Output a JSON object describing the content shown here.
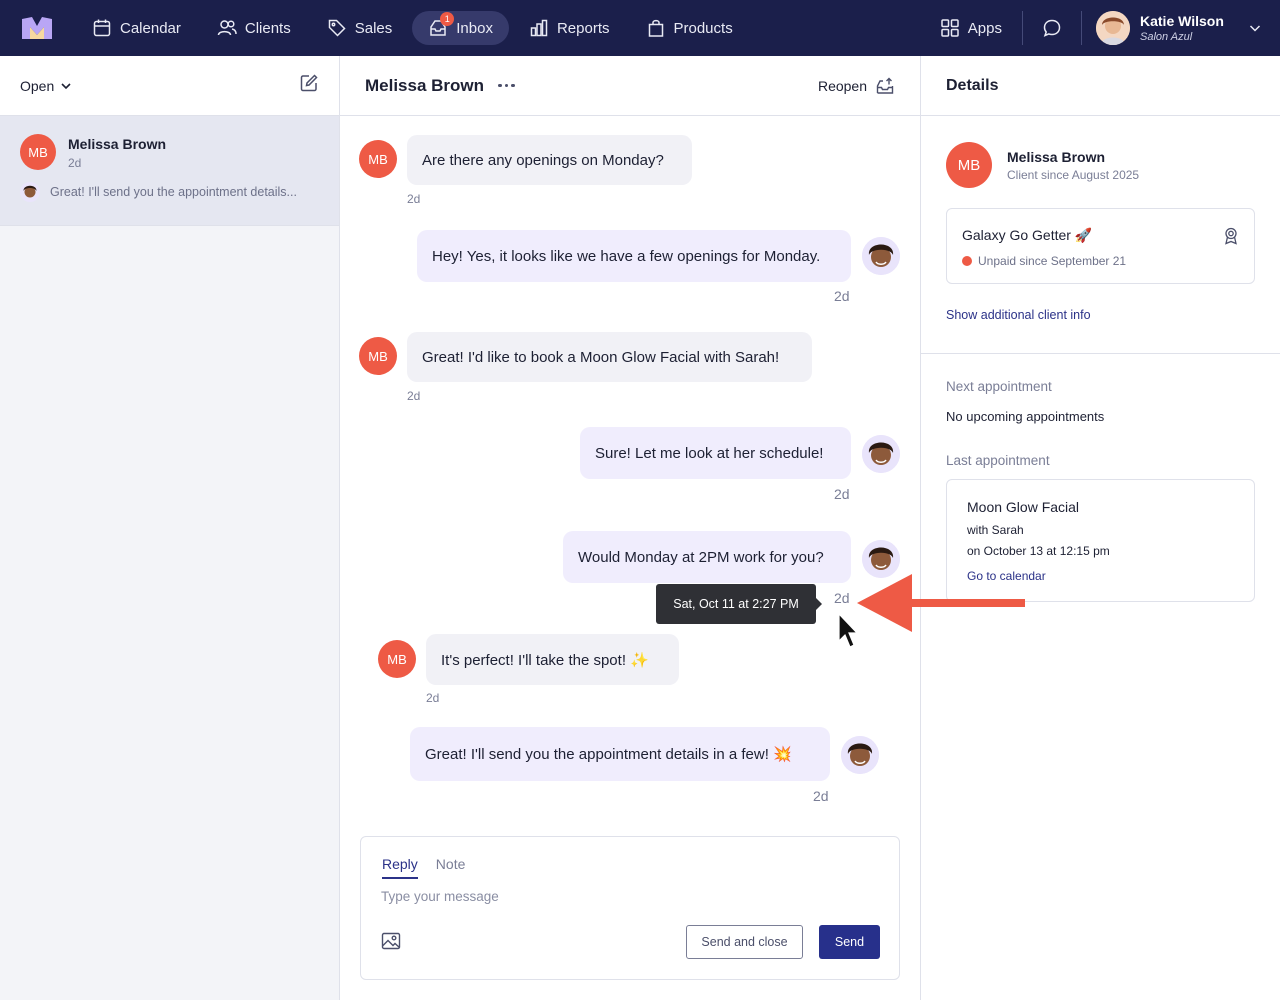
{
  "nav": {
    "items": [
      {
        "label": "Calendar",
        "icon": "calendar-icon"
      },
      {
        "label": "Clients",
        "icon": "users-icon"
      },
      {
        "label": "Sales",
        "icon": "tag-icon"
      },
      {
        "label": "Inbox",
        "icon": "inbox-icon",
        "badge": "1"
      },
      {
        "label": "Reports",
        "icon": "bar-chart-icon"
      },
      {
        "label": "Products",
        "icon": "shopping-bag-icon"
      }
    ],
    "apps_label": "Apps",
    "user_name": "Katie Wilson",
    "user_salon": "Salon Azul"
  },
  "left": {
    "filter_label": "Open",
    "conversation": {
      "initials": "MB",
      "name": "Melissa Brown",
      "time": "2d",
      "preview": "Great! I'll send you the appointment details..."
    }
  },
  "thread": {
    "title": "Melissa Brown",
    "reopen_label": "Reopen",
    "messages": [
      {
        "from": "client",
        "initials": "MB",
        "text": "Are there any openings on Monday?",
        "time": "2d"
      },
      {
        "from": "staff",
        "text": "Hey! Yes, it looks like we have a few openings for Monday.",
        "time": "2d"
      },
      {
        "from": "client",
        "initials": "MB",
        "text": "Great! I'd like to book a Moon Glow Facial with Sarah!",
        "time": "2d"
      },
      {
        "from": "staff",
        "text": "Sure! Let me look at her schedule!",
        "time": "2d"
      },
      {
        "from": "staff",
        "text": "Would Monday at 2PM work for you?",
        "time": "2d"
      },
      {
        "from": "client",
        "initials": "MB",
        "text": "It's perfect! I'll take the spot! ✨",
        "time": "2d"
      },
      {
        "from": "staff",
        "text": "Great! I'll send you the appointment details in a few! 💥",
        "time": "2d"
      }
    ],
    "tooltip": "Sat, Oct 11 at 2:27 PM"
  },
  "composer": {
    "tab_reply": "Reply",
    "tab_note": "Note",
    "placeholder": "Type your message",
    "send_close_label": "Send and close",
    "send_label": "Send"
  },
  "details": {
    "title": "Details",
    "client_initials": "MB",
    "client_name": "Melissa Brown",
    "client_since": "Client since August 2025",
    "membership_title": "Galaxy Go Getter 🚀",
    "membership_status": "Unpaid since September 21",
    "show_more": "Show additional client info",
    "next_label": "Next appointment",
    "next_value": "No upcoming appointments",
    "last_label": "Last appointment",
    "last_appt": {
      "service": "Moon Glow Facial",
      "with": "with Sarah",
      "on": "on October 13 at 12:15 pm",
      "link": "Go to calendar"
    }
  },
  "colors": {
    "nav_bg": "#1b1f4b",
    "accent": "#27308b",
    "client_avatar": "#ee5a45",
    "staff_bubble": "#f0edfd",
    "annotation_arrow": "#ee5a45"
  }
}
